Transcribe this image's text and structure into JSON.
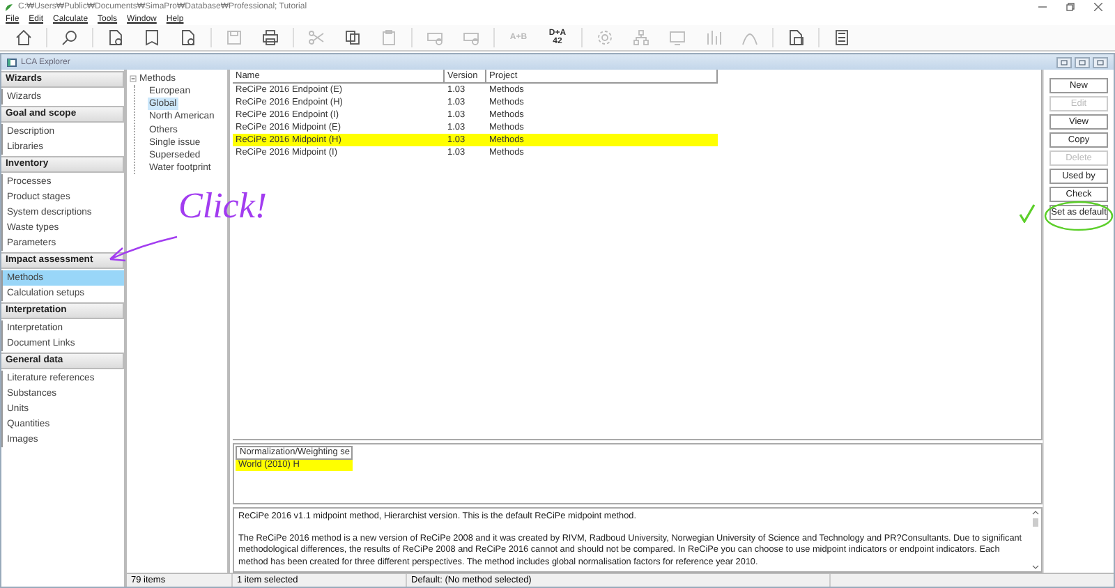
{
  "window": {
    "title": "C:₩Users₩Public₩Documents₩SimaPro₩Database₩Professional; Tutorial"
  },
  "menu": [
    "File",
    "Edit",
    "Calculate",
    "Tools",
    "Window",
    "Help"
  ],
  "toolbar_text_buttons": [
    {
      "text": "A+B",
      "disabled": true
    },
    {
      "text": "D+A 42",
      "disabled": false
    }
  ],
  "explorer": {
    "title": "LCA Explorer"
  },
  "sidebar": {
    "sections": [
      {
        "title": "Wizards",
        "items": [
          {
            "label": "Wizards",
            "selected": false
          }
        ]
      },
      {
        "title": "Goal and scope",
        "items": [
          {
            "label": "Description",
            "selected": false
          },
          {
            "label": "Libraries",
            "selected": false
          }
        ]
      },
      {
        "title": "Inventory",
        "items": [
          {
            "label": "Processes",
            "selected": false
          },
          {
            "label": "Product stages",
            "selected": false
          },
          {
            "label": "System descriptions",
            "selected": false
          },
          {
            "label": "Waste types",
            "selected": false
          },
          {
            "label": "Parameters",
            "selected": false
          }
        ]
      },
      {
        "title": "Impact assessment",
        "items": [
          {
            "label": "Methods",
            "selected": true
          },
          {
            "label": "Calculation setups",
            "selected": false
          }
        ]
      },
      {
        "title": "Interpretation",
        "items": [
          {
            "label": "Interpretation",
            "selected": false
          },
          {
            "label": "Document Links",
            "selected": false
          }
        ]
      },
      {
        "title": "General data",
        "items": [
          {
            "label": "Literature references",
            "selected": false
          },
          {
            "label": "Substances",
            "selected": false
          },
          {
            "label": "Units",
            "selected": false
          },
          {
            "label": "Quantities",
            "selected": false
          },
          {
            "label": "Images",
            "selected": false
          }
        ]
      }
    ]
  },
  "tree": {
    "label": "Methods",
    "expanded": true,
    "children": [
      {
        "label": "European",
        "selected": false
      },
      {
        "label": "Global",
        "selected": true
      },
      {
        "label": "North American",
        "selected": false
      },
      {
        "label": "Others",
        "selected": false
      },
      {
        "label": "Single issue",
        "selected": false
      },
      {
        "label": "Superseded",
        "selected": false
      },
      {
        "label": "Water footprint",
        "selected": false
      }
    ]
  },
  "table": {
    "columns": [
      "Name",
      "Version",
      "Project"
    ],
    "rows": [
      {
        "cells": [
          "ReCiPe 2016 Endpoint (E)",
          "1.03",
          "Methods"
        ],
        "selected": false
      },
      {
        "cells": [
          "ReCiPe 2016 Endpoint (H)",
          "1.03",
          "Methods"
        ],
        "selected": false
      },
      {
        "cells": [
          "ReCiPe 2016 Endpoint (I)",
          "1.03",
          "Methods"
        ],
        "selected": false
      },
      {
        "cells": [
          "ReCiPe 2016 Midpoint (E)",
          "1.03",
          "Methods"
        ],
        "selected": false
      },
      {
        "cells": [
          "ReCiPe 2016 Midpoint (H)",
          "1.03",
          "Methods"
        ],
        "selected": true
      },
      {
        "cells": [
          "ReCiPe 2016 Midpoint (I)",
          "1.03",
          "Methods"
        ],
        "selected": false
      }
    ]
  },
  "buttons": [
    {
      "label": "New",
      "disabled": false
    },
    {
      "label": "Edit",
      "disabled": true
    },
    {
      "label": "View",
      "disabled": false
    },
    {
      "label": "Copy",
      "disabled": false
    },
    {
      "label": "Delete",
      "disabled": true
    },
    {
      "label": "Used by",
      "disabled": false
    },
    {
      "label": "Check",
      "disabled": false
    },
    {
      "label": "Set as default",
      "disabled": false
    }
  ],
  "normalization": {
    "column": "Normalization/Weighting se",
    "rows": [
      {
        "label": "World (2010) H",
        "selected": true
      }
    ]
  },
  "description": [
    "ReCiPe 2016 v1.1 midpoint method, Hierarchist version. This is the default ReCiPe midpoint method.",
    "The ReCiPe 2016 method is a new version of ReCiPe 2008 and it was created by RIVM, Radboud University, Norwegian University of Science and Technology and PR?Consultants. Due to significant methodological differences, the results of ReCiPe 2008 and ReCiPe 2016 cannot and should not be compared. In ReCiPe you can choose to use midpoint indicators or endpoint indicators. Each method has been created for three different perspectives. The method includes global normalisation factors for reference year 2010."
  ],
  "status_bar": [
    "79 items",
    "1 item selected",
    "Default: (No method selected)"
  ],
  "annotations": {
    "note": "Click!"
  }
}
